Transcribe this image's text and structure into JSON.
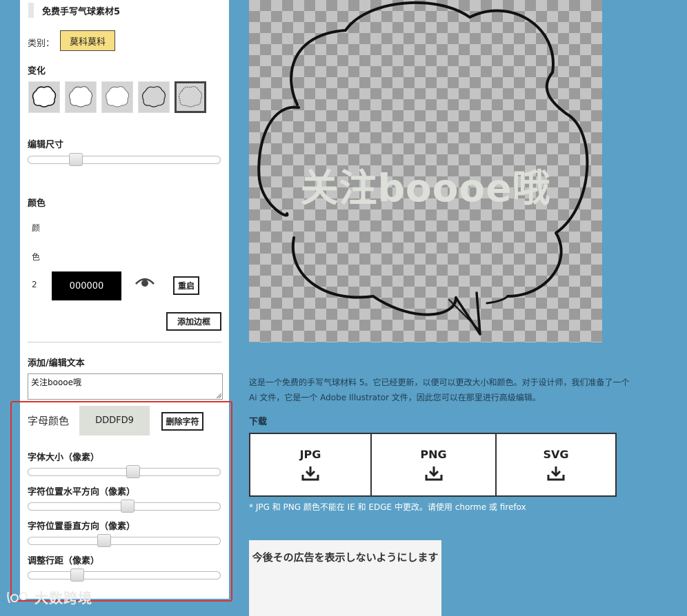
{
  "panel": {
    "title": "免费手写气球素材5",
    "category_label": "类别：",
    "category_value": "莫科莫科",
    "variation_label": "变化",
    "size_label": "编辑尺寸",
    "size_slider_value": 0.23,
    "color_section_label": "颜色",
    "color_row_chars": [
      "颜",
      "色",
      "2"
    ],
    "color_value": "000000",
    "reset_label": "重启",
    "add_border_label": "添加边框",
    "text_section_label": "添加/编辑文本",
    "text_value": "关注boooe哦",
    "letter_color_label": "字母颜色",
    "letter_color_value": "DDDFD9",
    "delete_char_label": "删除字符",
    "sliders": [
      {
        "label": "字体大小（像素）",
        "value": 0.55
      },
      {
        "label": "字符位置水平方向（像素）",
        "value": 0.52
      },
      {
        "label": "字符位置垂直方向（像素）",
        "value": 0.39
      },
      {
        "label": "调整行距（像素）",
        "value": 0.24
      }
    ]
  },
  "watermark": {
    "text": "大数跨境"
  },
  "preview": {
    "text": "关注boooe哦",
    "text_color": "#dddfd9",
    "stroke_color": "#000000"
  },
  "description": "这是一个免费的手写气球材料 5。它已经更新，以便可以更改大小和颜色。对于设计师，我们准备了一个 Ai 文件，它是一个 Adobe Illustrator 文件，因此您可以在那里进行高级编辑。",
  "download": {
    "label": "下载",
    "formats": [
      "JPG",
      "PNG",
      "SVG"
    ],
    "note": "* JPG 和 PNG 颜色不能在 IE 和 EDGE 中更改。请使用 chorme 或 firefox"
  },
  "ad": {
    "text": "今後その広告を表示しないようにします"
  },
  "colors": {
    "background": "#5ba0c6",
    "category_button": "#f7de82",
    "highlight_border": "#e0302a"
  },
  "icons": [
    "eye-icon",
    "download-icon",
    "bubble-variant-icon",
    "watermark-logo-icon"
  ]
}
